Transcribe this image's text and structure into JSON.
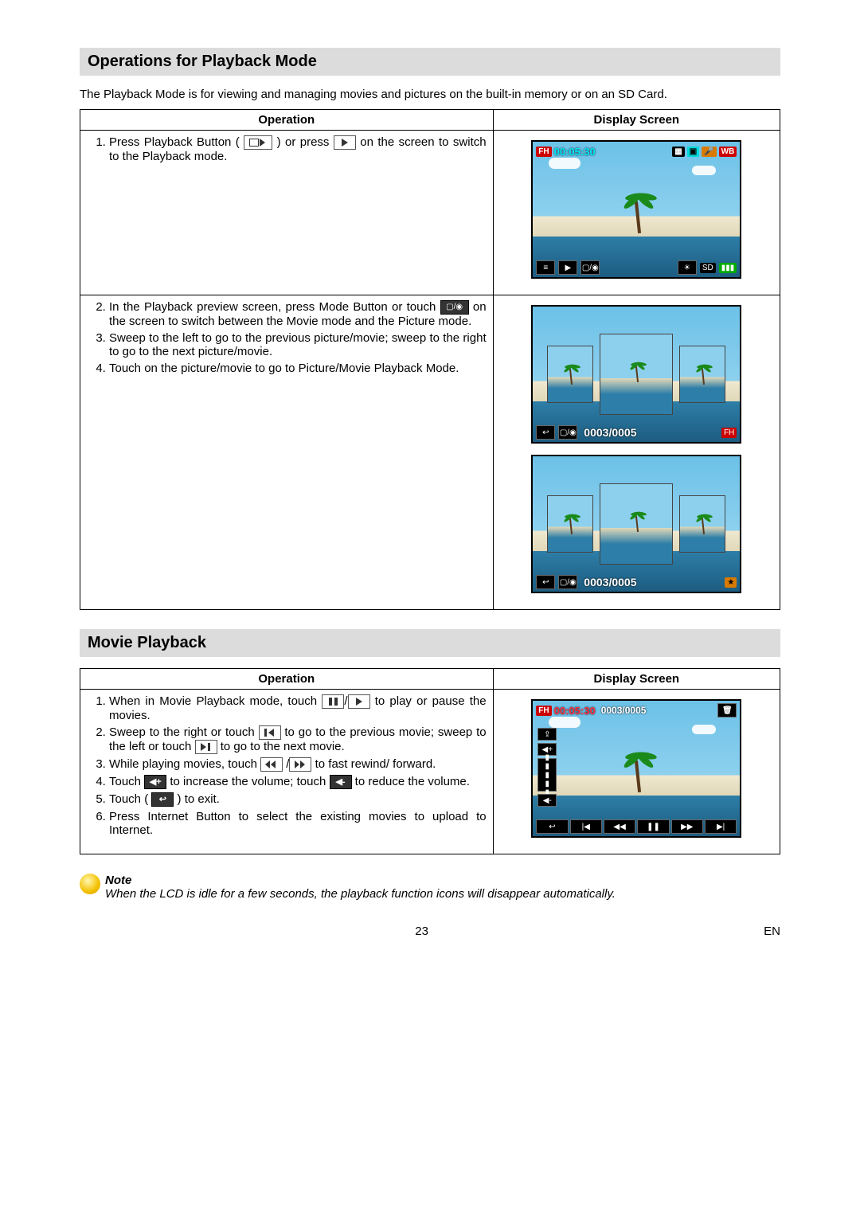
{
  "section1_title": "Operations for Playback Mode",
  "intro": "The Playback Mode is for viewing and managing movies and pictures on the built-in memory or on an SD Card.",
  "table1_headers": {
    "op": "Operation",
    "ds": "Display Screen"
  },
  "t1r1": {
    "s1a": "Press Playback Button (",
    "s1b": ") or press",
    "s1c": "on the screen to switch to the Playback mode."
  },
  "t1r2": {
    "s2a": "In the Playback preview screen, press Mode Button or touch",
    "s2b": "on the screen to switch between the Movie mode and the Picture mode.",
    "s3": "Sweep to the left to go to the previous picture/movie; sweep to the right to go to the next picture/movie.",
    "s4": "Touch on the picture/movie to go to Picture/Movie Playback Mode."
  },
  "screen1": {
    "fh_badge": "FH",
    "time": "00:05:30",
    "wb": "WB",
    "sd": "SD",
    "menu_icon": "≡"
  },
  "screen2": {
    "back": "↩",
    "mode": "▢/◉",
    "counter": "0003/0005",
    "fh_badge": "FH"
  },
  "screen3": {
    "back": "↩",
    "mode": "▢/◉",
    "counter": "0003/0005",
    "fav": "★"
  },
  "section2_title": "Movie Playback",
  "table2_headers": {
    "op": "Operation",
    "ds": "Display Screen"
  },
  "t2": {
    "s1a": "When in Movie Playback mode, touch",
    "s1b": "/",
    "s1c": "to play or pause the movies.",
    "s2a": "Sweep to the right or touch",
    "s2b": "to go to the previous movie; sweep to the left or touch",
    "s2c": "to go to the next movie.",
    "s3a": "While playing movies, touch",
    "s3b": "/",
    "s3c": "to fast rewind/ forward.",
    "s4a": "Touch",
    "s4b": "to increase the volume; touch",
    "s4c": "to reduce the volume.",
    "s5a": "Touch (",
    "s5b": ") to exit.",
    "s6": "Press Internet Button to select the existing movies to upload to Internet."
  },
  "screen4": {
    "fh_badge": "FH",
    "time": "00:05:30",
    "counter": "0003/0005",
    "trash": "🗑"
  },
  "note_title": "Note",
  "note_text": "When the LCD is idle for a few seconds, the playback function icons will disappear automatically.",
  "page_number": "23",
  "lang": "EN"
}
